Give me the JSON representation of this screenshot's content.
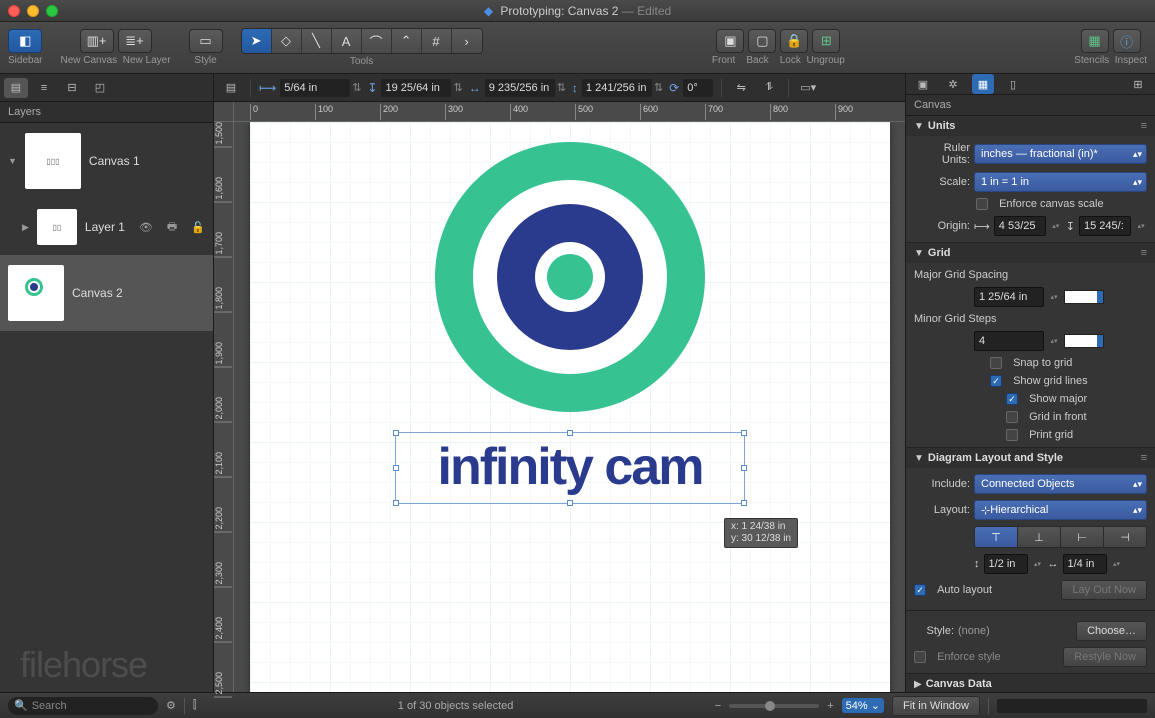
{
  "window": {
    "title": "Prototyping: Canvas 2",
    "modified": " — Edited"
  },
  "toolbar": {
    "sidebar": "Sidebar",
    "newCanvas": "New Canvas",
    "newLayer": "New Layer",
    "style": "Style",
    "tools": "Tools",
    "front": "Front",
    "back": "Back",
    "lock": "Lock",
    "ungroup": "Ungroup",
    "stencils": "Stencils",
    "inspect": "Inspect"
  },
  "metrics": {
    "x": "5/64 in",
    "y": "19 25/64 in",
    "w": "9 235/256 in",
    "h": "1 241/256 in",
    "rot": "0°"
  },
  "rulerH": [
    "0",
    "100",
    "200",
    "300",
    "400",
    "500",
    "600",
    "700",
    "800",
    "900"
  ],
  "rulerV": [
    "1,500",
    "1,600",
    "1,700",
    "1,800",
    "1,900",
    "2,000",
    "2,100",
    "2,200",
    "2,300",
    "2,400",
    "2,500"
  ],
  "layersTitle": "Layers",
  "layers": {
    "canvas1": "Canvas 1",
    "layer1": "Layer 1",
    "canvas2": "Canvas 2"
  },
  "canvasText": "infinity cam",
  "tooltip": {
    "x": "x: 1 24/38 in",
    "y": "y: 30 12/38 in"
  },
  "colors": {
    "green": "#37c391",
    "blue": "#2a3b8e"
  },
  "inspector": {
    "canvasTitle": "Canvas",
    "units": {
      "title": "Units",
      "rulerUnitsLbl": "Ruler Units:",
      "rulerUnits": "inches — fractional (in)*",
      "scaleLbl": "Scale:",
      "scale": "1 in = 1 in",
      "enforce": "Enforce canvas scale",
      "originLbl": "Origin:",
      "ox": "4 53/25",
      "oy": "15 245/:"
    },
    "grid": {
      "title": "Grid",
      "majorLbl": "Major Grid Spacing",
      "major": "1 25/64 in",
      "minorLbl": "Minor Grid Steps",
      "minor": "4",
      "snap": "Snap to grid",
      "show": "Show grid lines",
      "showMajor": "Show major",
      "front": "Grid in front",
      "print": "Print grid"
    },
    "diagram": {
      "title": "Diagram Layout and Style",
      "includeLbl": "Include:",
      "include": "Connected Objects",
      "layoutLbl": "Layout:",
      "layout": "Hierarchical",
      "spacing1": "1/2 in",
      "spacing2": "1/4 in",
      "auto": "Auto layout",
      "layOut": "Lay Out Now",
      "styleLbl": "Style:",
      "styleVal": "(none)",
      "choose": "Choose…",
      "enforceStyle": "Enforce style",
      "restyle": "Restyle Now"
    },
    "canvasData": "Canvas Data"
  },
  "status": {
    "search": "Search",
    "selection": "1 of 30 objects selected",
    "zoom": "54%",
    "fit": "Fit in Window"
  },
  "watermark": "filehorse"
}
